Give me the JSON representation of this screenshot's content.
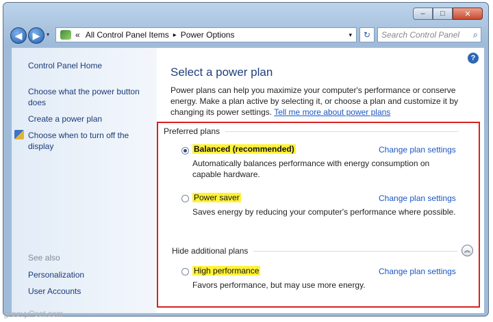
{
  "window": {
    "minimize": "–",
    "maximize": "□",
    "close": "✕"
  },
  "address": {
    "chevrons": "«",
    "crumbs": [
      "All Control Panel Items",
      "Power Options"
    ],
    "separator": "▸",
    "dropdown": "▾",
    "refresh": "↻",
    "search_placeholder": "Search Control Panel",
    "search_icon": "⌕"
  },
  "nav": {
    "back": "◀",
    "forward": "▶",
    "history_dropdown": "▾"
  },
  "sidebar": {
    "home": "Control Panel Home",
    "links": [
      "Choose what the power button does",
      "Create a power plan",
      "Choose when to turn off the display"
    ],
    "see_also_heading": "See also",
    "see_also": [
      "Personalization",
      "User Accounts"
    ]
  },
  "main": {
    "help": "?",
    "title": "Select a power plan",
    "description": "Power plans can help you maximize your computer's performance or conserve energy. Make a plan active by selecting it, or choose a plan and customize it by changing its power settings.",
    "tell_me_more": "Tell me more about power plans"
  },
  "plans": {
    "preferred_header": "Preferred plans",
    "hide_header": "Hide additional plans",
    "collapse_icon": "︽",
    "change_label": "Change plan settings",
    "items": [
      {
        "name": "Balanced (recommended)",
        "selected": true,
        "description": "Automatically balances performance with energy consumption on capable hardware."
      },
      {
        "name": "Power saver",
        "selected": false,
        "description": "Saves energy by reducing your computer's performance where possible."
      },
      {
        "name": "High performance",
        "selected": false,
        "description": "Favors performance, but may use more energy."
      }
    ]
  },
  "watermark": "groovyPost.com",
  "colors": {
    "highlight": "#fff238",
    "box_outline": "#d72020",
    "link": "#1b56c2"
  }
}
